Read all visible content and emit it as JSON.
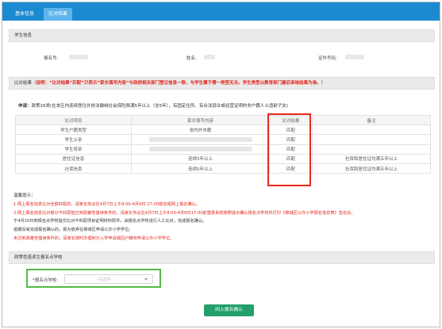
{
  "tabs": [
    {
      "label": "基本信息"
    },
    {
      "label": "比对结果"
    }
  ],
  "student_section": {
    "title": "学生信息",
    "fields": [
      {
        "label": "报名号:"
      },
      {
        "label": "姓名:"
      },
      {
        "label": "证件号码:"
      }
    ]
  },
  "result_section": {
    "title_prefix": "比对结果（",
    "title_note": "说明：“比对结果”匹配”只表示”家长填写内容”与政府相关部门登记信息一致，与学生属于哪一类型无关。学生类型以教育部门最后审核结果为准。",
    "title_suffix": "）"
  },
  "application": {
    "label": "申请：",
    "text": "政策16类(在本区内连续居住并依法缴纳社会保险费满5年以上（含5年），有固定住所、有合法就业或经营证明的非户籍人士适龄子女)"
  },
  "compare_table": {
    "headers": [
      "比对项目",
      "家长填写内容",
      "比对结果",
      "备注"
    ],
    "rows": [
      {
        "item": "学生户籍类型",
        "content": "省内外市籍",
        "result": "匹配",
        "note": ""
      },
      {
        "item": "学生父亲",
        "content": "",
        "result": "匹配",
        "note": ""
      },
      {
        "item": "学生母亲",
        "content": "",
        "result": "匹配",
        "note": ""
      },
      {
        "item": "居住证信息",
        "content": "连续5年以上",
        "result": "匹配",
        "note": "社保和居住证均满五年以上"
      },
      {
        "item": "社保信息",
        "content": "连续5年以上",
        "result": "匹配",
        "note": "社保和居住证均满五年以上"
      }
    ]
  },
  "notes": {
    "title": "温馨提示：",
    "line1": "1.网上报名信息比对全部匹配的，请家长务必在4月7日上午9:00-4月9日 17:00前完成网上报名确认。",
    "line2": "2.网上报名信息比对部分不匹配但达到政策性借读条件的，请家长务必在4月7日上午9:00-4月8日17:00前登录系统按照提示确认报名点学校并打印《樟城区公办小学报名信息表》签名后，",
    "line3": "于4月10日到报名点学校提交比对不匹配项目证明材料原件，由报名点学校进行人工比对，完成报名确认。",
    "line4": "逾期没有完成报名确认的，视为放弃在樟城区申请公办小学学位。",
    "line5": "未达到政策性借读条件的，请家长按时办理积分入学申请或回户籍地申请公办小学学位。"
  },
  "school_section": {
    "title": "政策性借读生报名点学校",
    "select_label": "*报名点学校:",
    "select_placeholder": "--请选择--"
  },
  "submit_button": {
    "label": "网上报名确认"
  },
  "colors": {
    "tabbar": "#1c8ad1",
    "active_tab": "#5db3ec",
    "match_green": "#18a84b",
    "alert_red": "#e0261b",
    "highlight_red": "#e82a1e",
    "highlight_green": "#55b947",
    "button_green": "#22a06a"
  },
  "icons": {
    "select_caret": "chevron-down-icon"
  }
}
